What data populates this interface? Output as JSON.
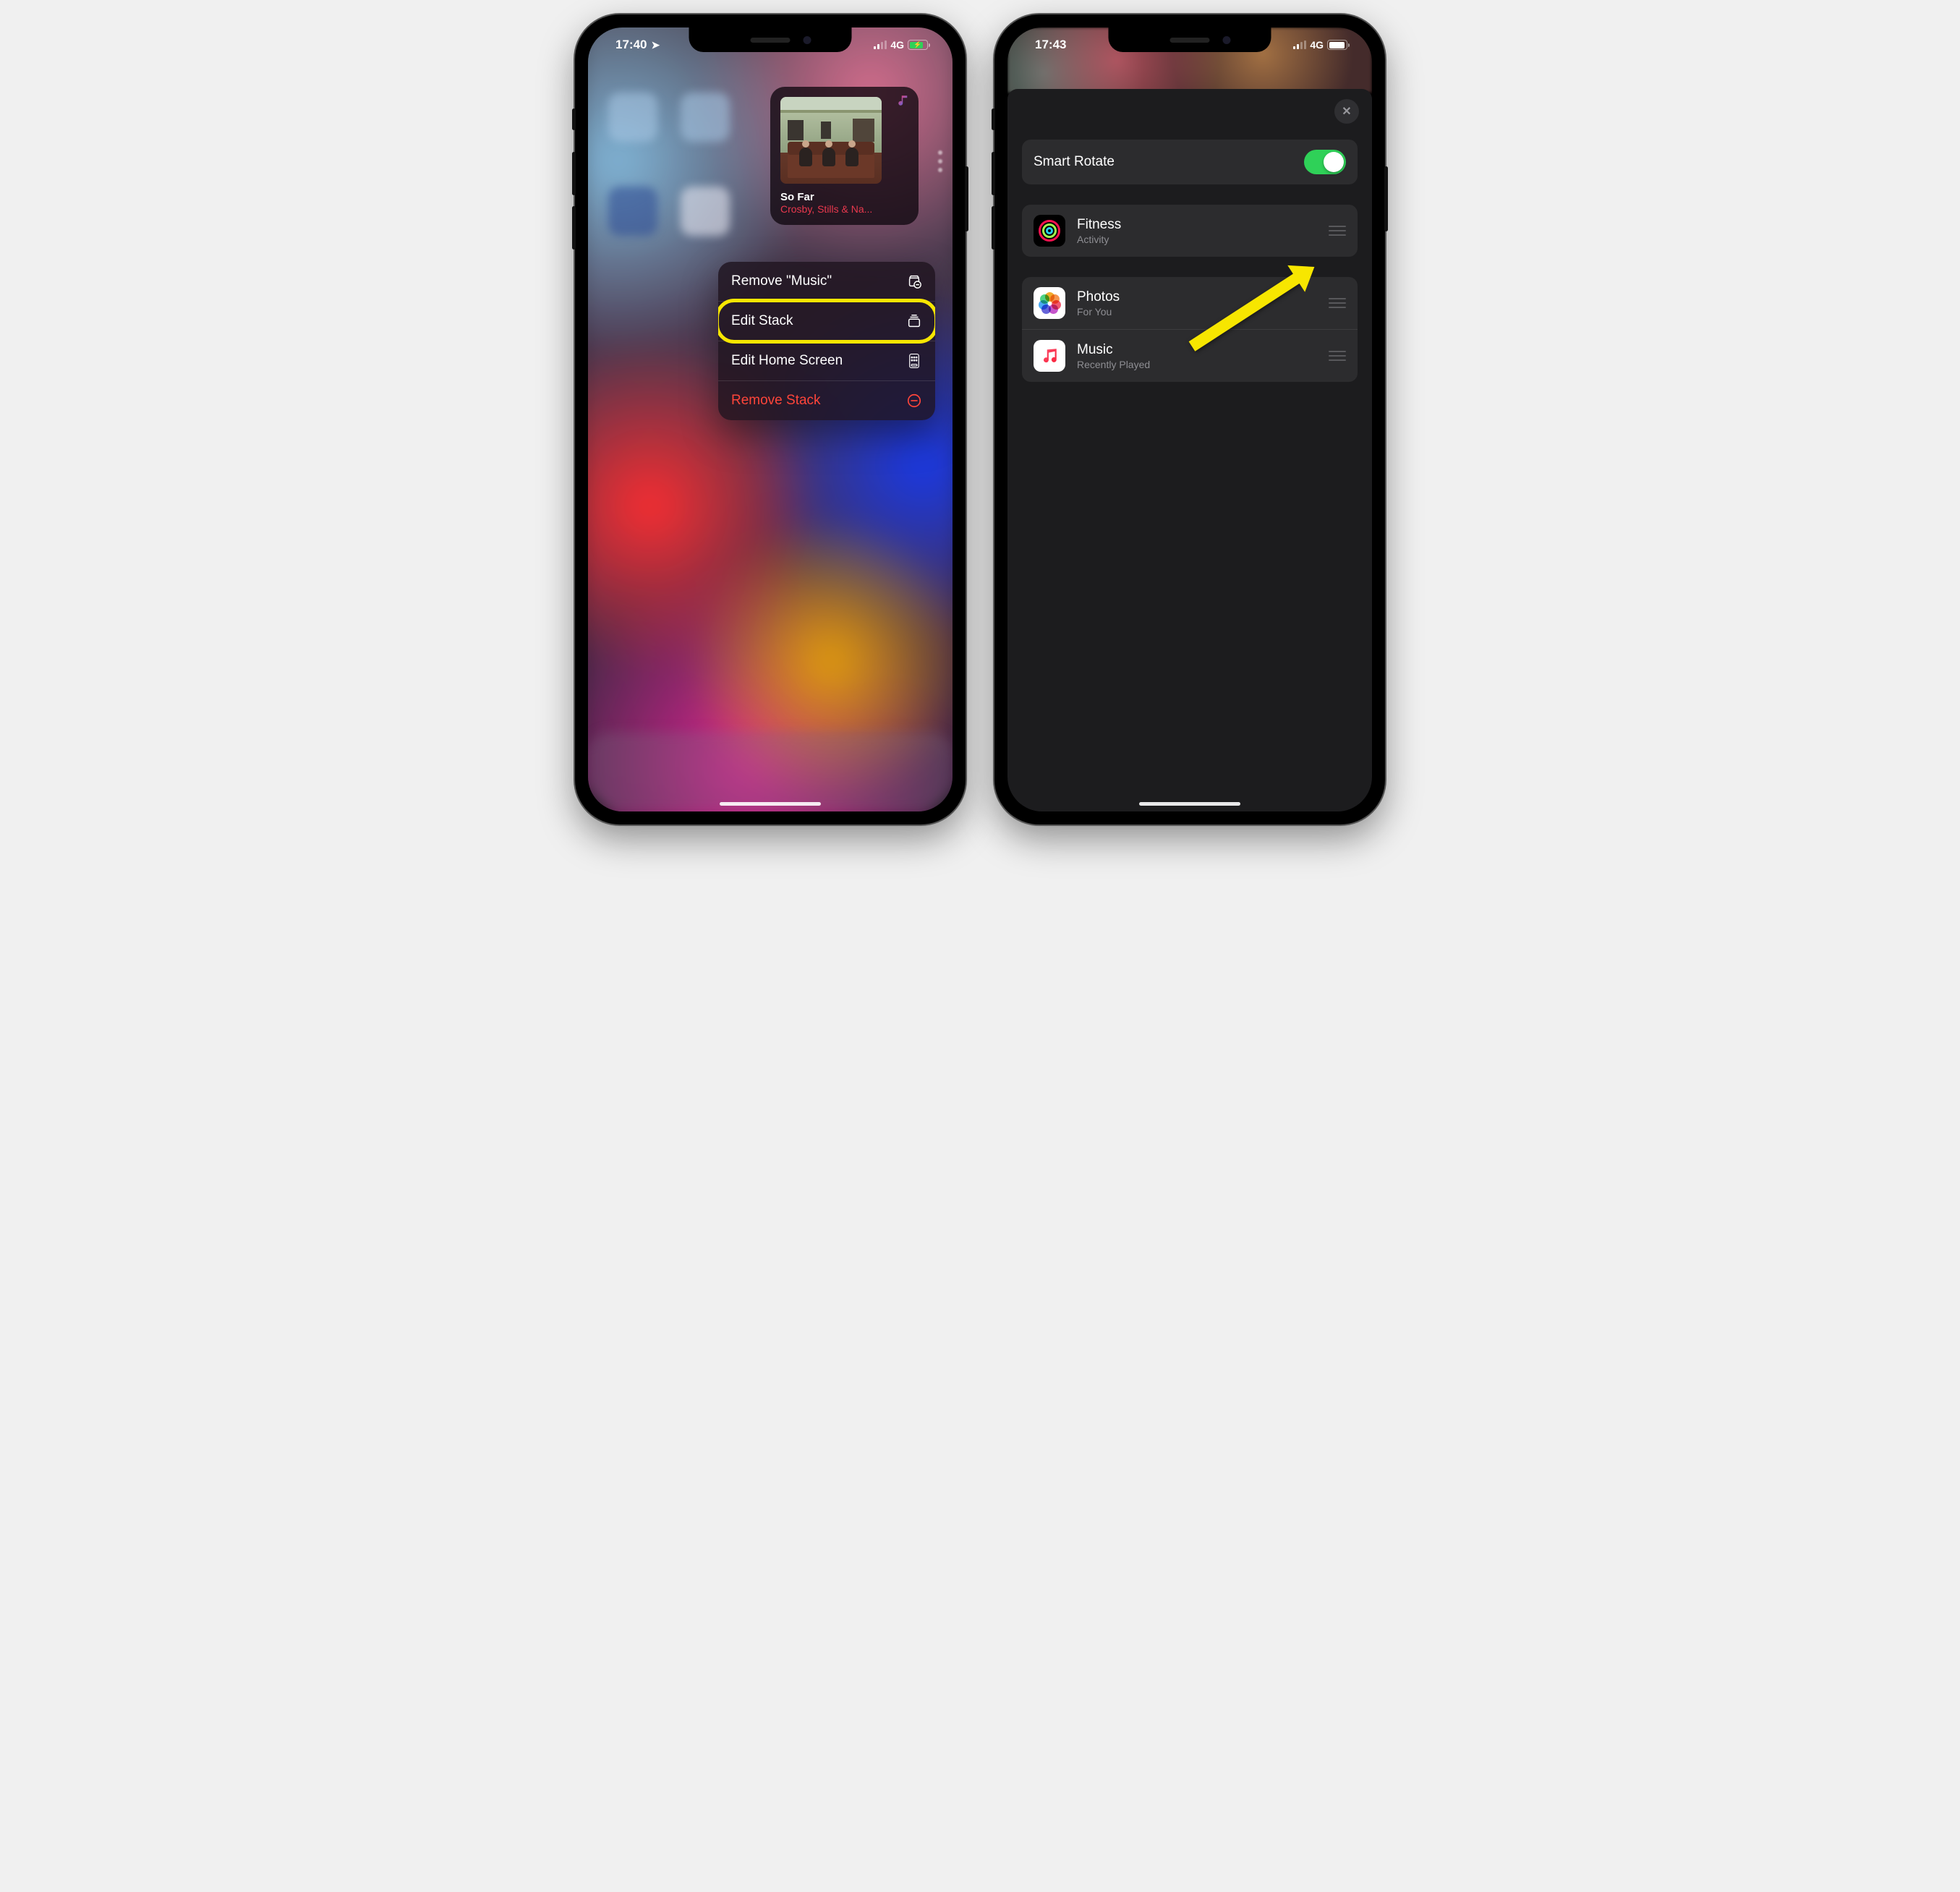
{
  "left": {
    "status": {
      "time": "17:40",
      "network": "4G"
    },
    "widget": {
      "app": "Music",
      "track_title": "So Far",
      "track_artist": "Crosby, Stills & Na..."
    },
    "menu": {
      "remove_app": "Remove \"Music\"",
      "edit_stack": "Edit Stack",
      "edit_home": "Edit Home Screen",
      "remove_stack": "Remove Stack"
    }
  },
  "right": {
    "status": {
      "time": "17:43",
      "network": "4G"
    },
    "sheet": {
      "smart_rotate": "Smart Rotate",
      "items": [
        {
          "name": "Fitness",
          "sub": "Activity"
        },
        {
          "name": "Photos",
          "sub": "For You"
        },
        {
          "name": "Music",
          "sub": "Recently Played"
        }
      ]
    }
  }
}
